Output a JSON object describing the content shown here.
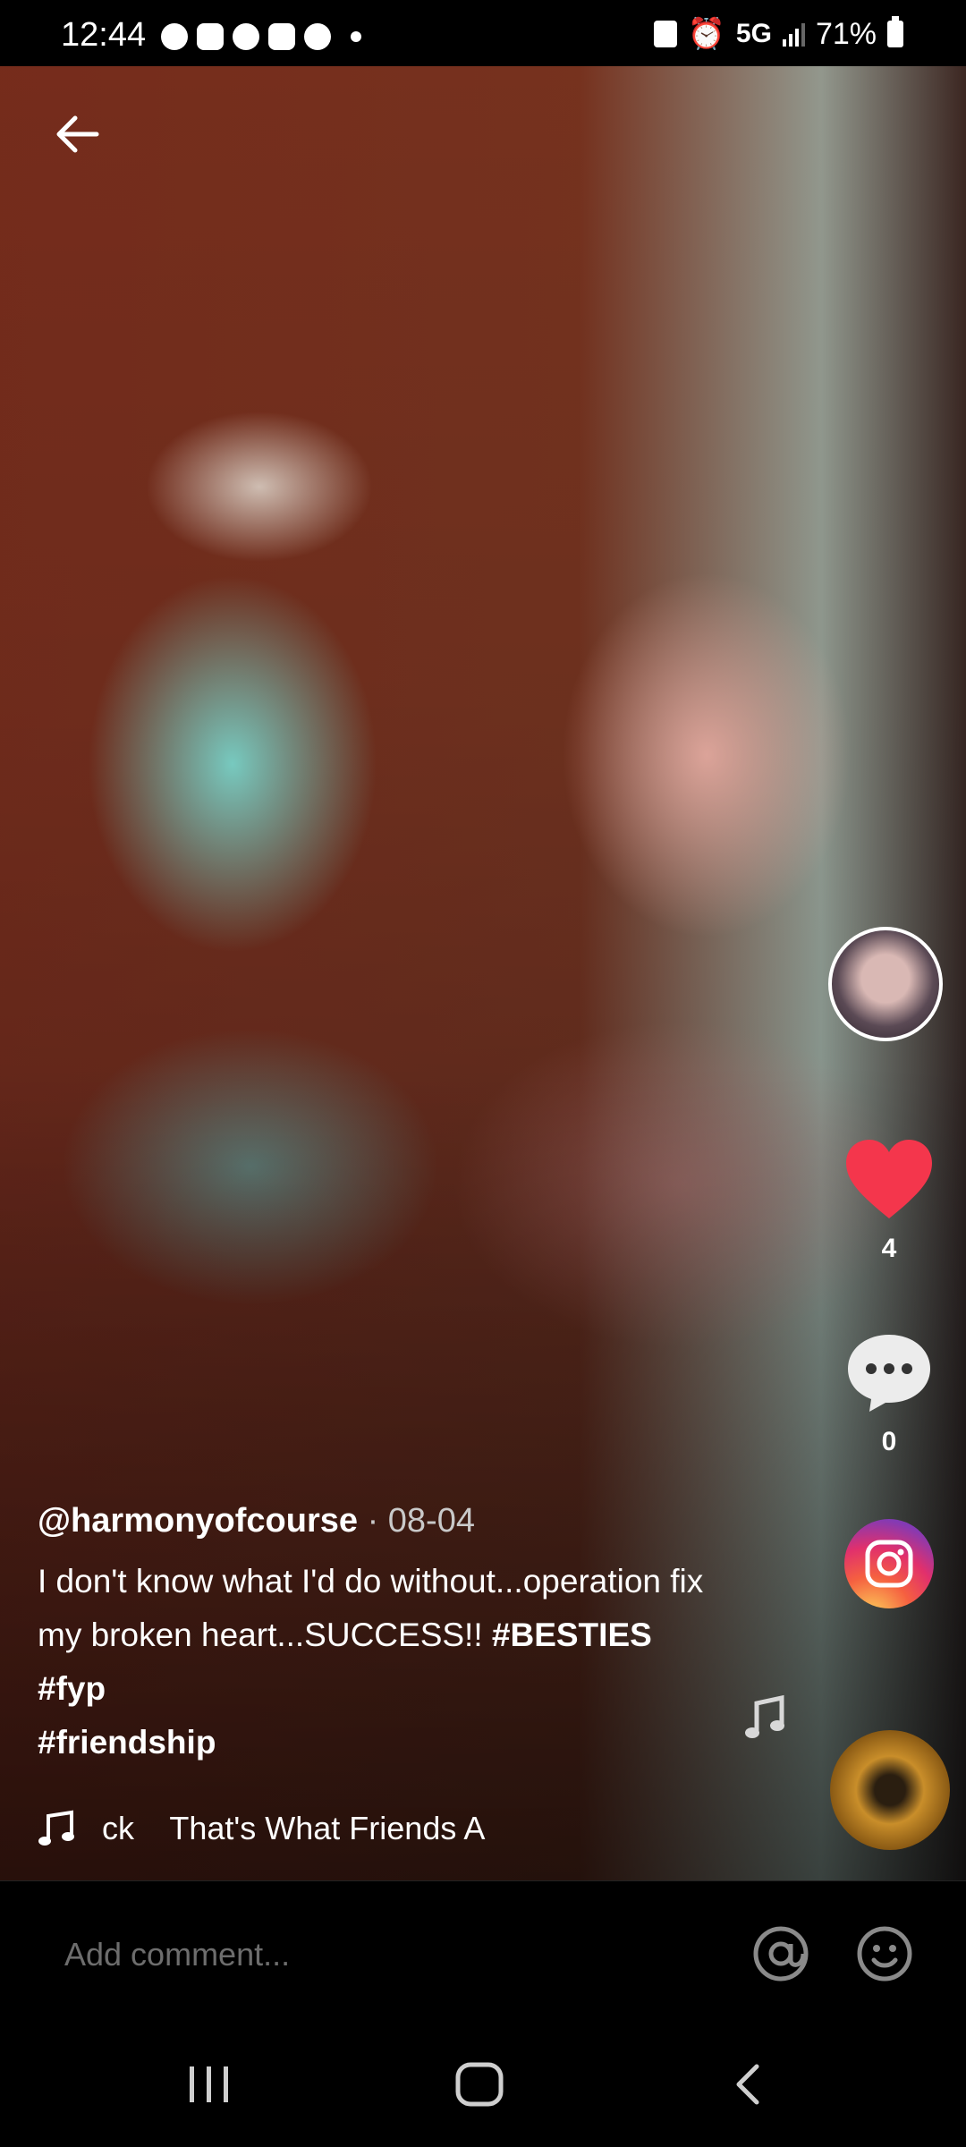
{
  "status_bar": {
    "time": "12:44",
    "network": "5G",
    "battery": "71%"
  },
  "post": {
    "username": "@harmonyofcourse",
    "date": "· 08-04",
    "description_text": "I don't know what I'd do without...operation fix my broken heart...SUCCESS!! ",
    "hashtags": [
      "#BESTIES",
      "#fyp",
      "#friendship"
    ],
    "sound": "ck    That's What Friends A"
  },
  "actions": {
    "likes": "4",
    "comments": "0"
  },
  "comment_bar": {
    "placeholder": "Add comment..."
  },
  "icons": {
    "back": "arrow-left-icon",
    "like": "heart-icon",
    "comment": "chat-bubble-icon",
    "share": "instagram-icon",
    "sound": "music-note-icon",
    "mention": "at-sign-icon",
    "emoji": "smiley-icon"
  },
  "colors": {
    "like": "#f4364c",
    "background": "#000000",
    "placeholder": "#6d6d6d"
  }
}
